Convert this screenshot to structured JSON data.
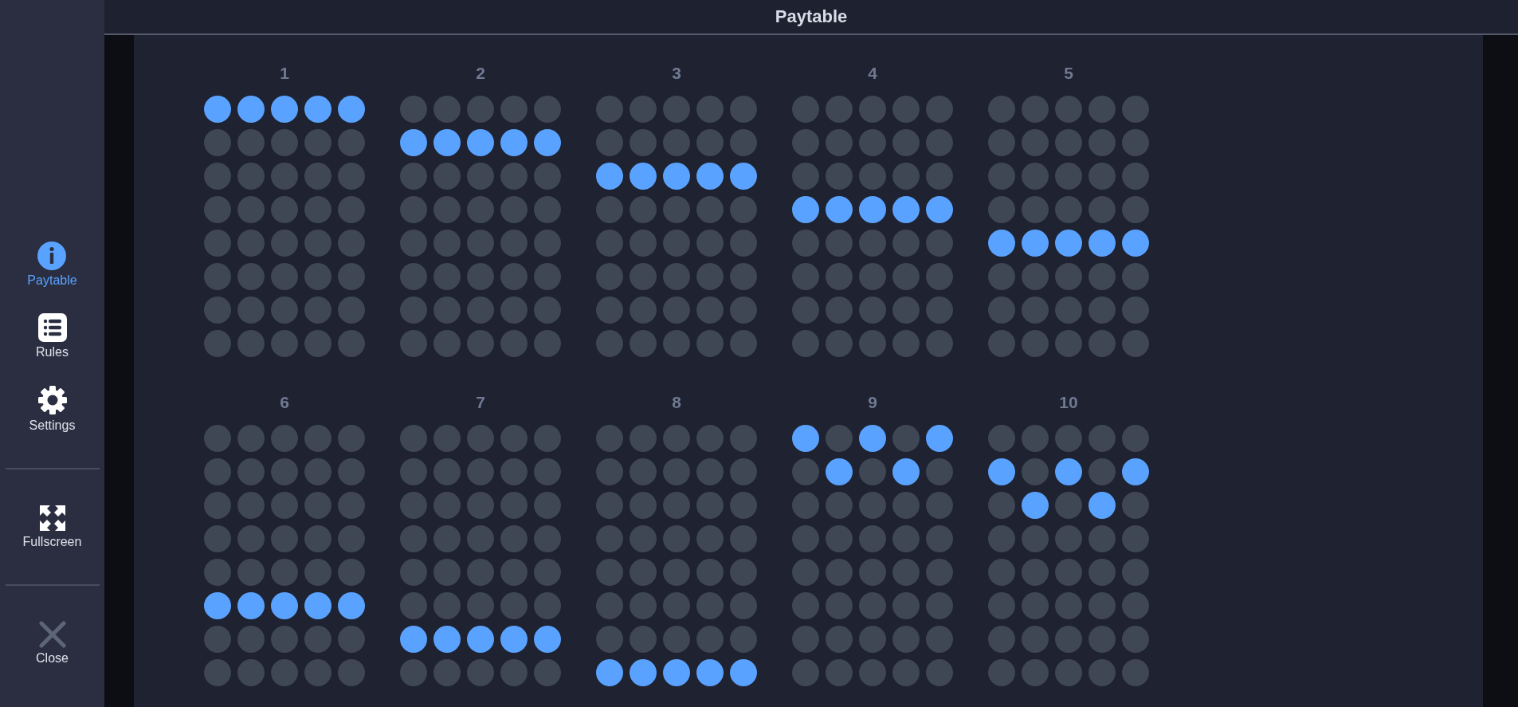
{
  "header": {
    "title": "Paytable"
  },
  "sidebar": {
    "sections": [
      [
        {
          "label": "Paytable",
          "selected": true
        },
        {
          "label": "Rules",
          "selected": false
        },
        {
          "label": "Settings",
          "selected": false
        }
      ],
      [
        {
          "label": "Fullscreen",
          "selected": false
        }
      ],
      [
        {
          "label": "Close",
          "selected": false
        }
      ]
    ]
  },
  "paylines": [
    {
      "number": "1",
      "grid": [
        [
          true,
          true,
          true,
          true,
          true
        ],
        [
          false,
          false,
          false,
          false,
          false
        ],
        [
          false,
          false,
          false,
          false,
          false
        ],
        [
          false,
          false,
          false,
          false,
          false
        ],
        [
          false,
          false,
          false,
          false,
          false
        ],
        [
          false,
          false,
          false,
          false,
          false
        ],
        [
          false,
          false,
          false,
          false,
          false
        ],
        [
          false,
          false,
          false,
          false,
          false
        ]
      ]
    },
    {
      "number": "2",
      "grid": [
        [
          false,
          false,
          false,
          false,
          false
        ],
        [
          true,
          true,
          true,
          true,
          true
        ],
        [
          false,
          false,
          false,
          false,
          false
        ],
        [
          false,
          false,
          false,
          false,
          false
        ],
        [
          false,
          false,
          false,
          false,
          false
        ],
        [
          false,
          false,
          false,
          false,
          false
        ],
        [
          false,
          false,
          false,
          false,
          false
        ],
        [
          false,
          false,
          false,
          false,
          false
        ]
      ]
    },
    {
      "number": "3",
      "grid": [
        [
          false,
          false,
          false,
          false,
          false
        ],
        [
          false,
          false,
          false,
          false,
          false
        ],
        [
          true,
          true,
          true,
          true,
          true
        ],
        [
          false,
          false,
          false,
          false,
          false
        ],
        [
          false,
          false,
          false,
          false,
          false
        ],
        [
          false,
          false,
          false,
          false,
          false
        ],
        [
          false,
          false,
          false,
          false,
          false
        ],
        [
          false,
          false,
          false,
          false,
          false
        ]
      ]
    },
    {
      "number": "4",
      "grid": [
        [
          false,
          false,
          false,
          false,
          false
        ],
        [
          false,
          false,
          false,
          false,
          false
        ],
        [
          false,
          false,
          false,
          false,
          false
        ],
        [
          true,
          true,
          true,
          true,
          true
        ],
        [
          false,
          false,
          false,
          false,
          false
        ],
        [
          false,
          false,
          false,
          false,
          false
        ],
        [
          false,
          false,
          false,
          false,
          false
        ],
        [
          false,
          false,
          false,
          false,
          false
        ]
      ]
    },
    {
      "number": "5",
      "grid": [
        [
          false,
          false,
          false,
          false,
          false
        ],
        [
          false,
          false,
          false,
          false,
          false
        ],
        [
          false,
          false,
          false,
          false,
          false
        ],
        [
          false,
          false,
          false,
          false,
          false
        ],
        [
          true,
          true,
          true,
          true,
          true
        ],
        [
          false,
          false,
          false,
          false,
          false
        ],
        [
          false,
          false,
          false,
          false,
          false
        ],
        [
          false,
          false,
          false,
          false,
          false
        ]
      ]
    },
    {
      "number": "6",
      "grid": [
        [
          false,
          false,
          false,
          false,
          false
        ],
        [
          false,
          false,
          false,
          false,
          false
        ],
        [
          false,
          false,
          false,
          false,
          false
        ],
        [
          false,
          false,
          false,
          false,
          false
        ],
        [
          false,
          false,
          false,
          false,
          false
        ],
        [
          true,
          true,
          true,
          true,
          true
        ],
        [
          false,
          false,
          false,
          false,
          false
        ],
        [
          false,
          false,
          false,
          false,
          false
        ]
      ]
    },
    {
      "number": "7",
      "grid": [
        [
          false,
          false,
          false,
          false,
          false
        ],
        [
          false,
          false,
          false,
          false,
          false
        ],
        [
          false,
          false,
          false,
          false,
          false
        ],
        [
          false,
          false,
          false,
          false,
          false
        ],
        [
          false,
          false,
          false,
          false,
          false
        ],
        [
          false,
          false,
          false,
          false,
          false
        ],
        [
          true,
          true,
          true,
          true,
          true
        ],
        [
          false,
          false,
          false,
          false,
          false
        ]
      ]
    },
    {
      "number": "8",
      "grid": [
        [
          false,
          false,
          false,
          false,
          false
        ],
        [
          false,
          false,
          false,
          false,
          false
        ],
        [
          false,
          false,
          false,
          false,
          false
        ],
        [
          false,
          false,
          false,
          false,
          false
        ],
        [
          false,
          false,
          false,
          false,
          false
        ],
        [
          false,
          false,
          false,
          false,
          false
        ],
        [
          false,
          false,
          false,
          false,
          false
        ],
        [
          true,
          true,
          true,
          true,
          true
        ]
      ]
    },
    {
      "number": "9",
      "grid": [
        [
          true,
          false,
          true,
          false,
          true
        ],
        [
          false,
          true,
          false,
          true,
          false
        ],
        [
          false,
          false,
          false,
          false,
          false
        ],
        [
          false,
          false,
          false,
          false,
          false
        ],
        [
          false,
          false,
          false,
          false,
          false
        ],
        [
          false,
          false,
          false,
          false,
          false
        ],
        [
          false,
          false,
          false,
          false,
          false
        ],
        [
          false,
          false,
          false,
          false,
          false
        ]
      ]
    },
    {
      "number": "10",
      "grid": [
        [
          false,
          false,
          false,
          false,
          false
        ],
        [
          true,
          false,
          true,
          false,
          true
        ],
        [
          false,
          true,
          false,
          true,
          false
        ],
        [
          false,
          false,
          false,
          false,
          false
        ],
        [
          false,
          false,
          false,
          false,
          false
        ],
        [
          false,
          false,
          false,
          false,
          false
        ],
        [
          false,
          false,
          false,
          false,
          false
        ],
        [
          false,
          false,
          false,
          false,
          false
        ]
      ]
    }
  ]
}
